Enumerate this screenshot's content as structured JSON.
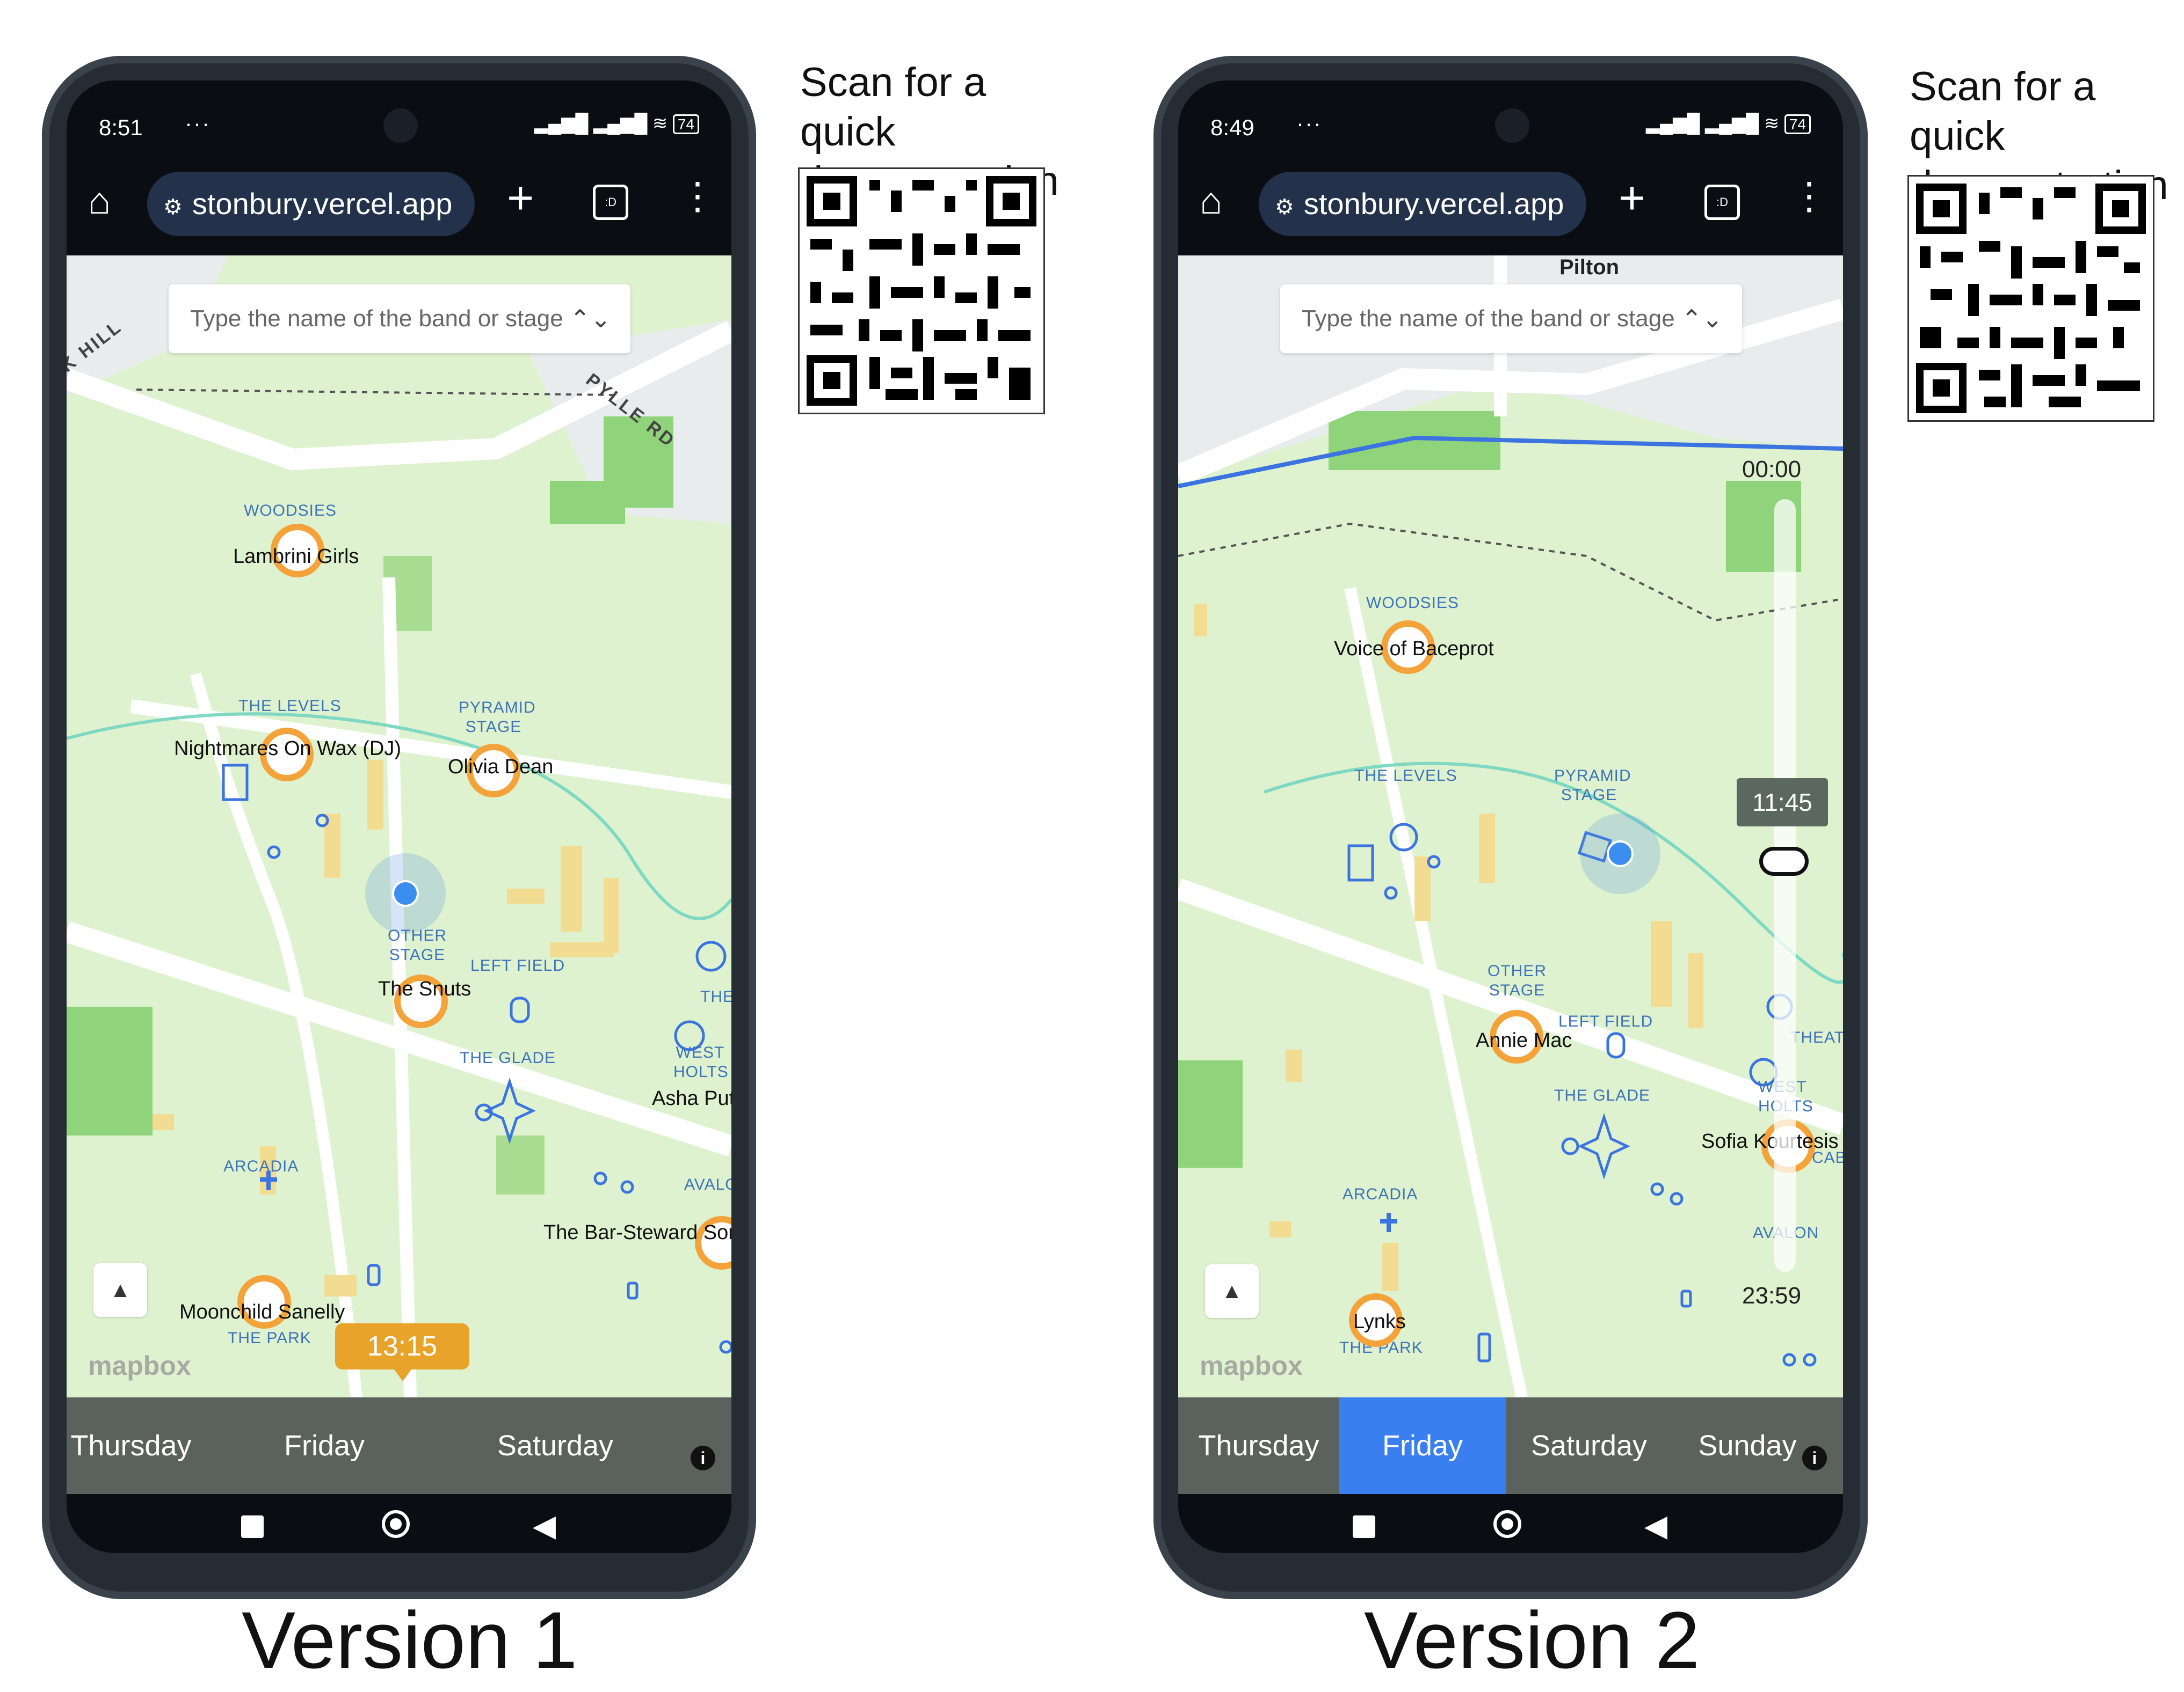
{
  "version1": {
    "status": {
      "time": "8:51",
      "dots": "···",
      "battery": "74"
    },
    "browser": {
      "url": "stonbury.vercel.app",
      "tabs_label": ":D"
    },
    "search": {
      "placeholder": "Type the name of the band or stage"
    },
    "road_labels": [
      "K HILL",
      "PYLLE RD"
    ],
    "stages": [
      {
        "name": "WOODSIES",
        "act": "Lambrini Girls"
      },
      {
        "name": "THE LEVELS",
        "act": "Nightmares On Wax (DJ)"
      },
      {
        "name": "PYRAMID STAGE",
        "act": "Olivia Dean"
      },
      {
        "name": "OTHER STAGE",
        "act": "The Snuts"
      },
      {
        "name": "LEFT FIELD",
        "act": ""
      },
      {
        "name": "THE GLADE",
        "act": ""
      },
      {
        "name": "WEST HOLTS",
        "act": "Asha Put"
      },
      {
        "name": "ARCADIA",
        "act": ""
      },
      {
        "name": "AVALON",
        "act": "The Bar-Steward Son"
      },
      {
        "name": "THE PARK",
        "act": "Moonchild Sanelly"
      },
      {
        "name": "THE",
        "act": ""
      }
    ],
    "time_tooltip": "13:15",
    "days": [
      "Thursday",
      "Friday",
      "Saturday"
    ],
    "caption": "Version 1",
    "qr_caption": "Scan for a quick demonstration"
  },
  "version2": {
    "status": {
      "time": "8:49",
      "dots": "···",
      "battery": "74"
    },
    "browser": {
      "url": "stonbury.vercel.app",
      "tabs_label": ":D"
    },
    "search": {
      "placeholder": "Type the name of the band or stage"
    },
    "place": "Pilton",
    "stages": [
      {
        "name": "WOODSIES",
        "act": "Voice of Baceprot"
      },
      {
        "name": "THE LEVELS",
        "act": ""
      },
      {
        "name": "PYRAMID STAGE",
        "act": ""
      },
      {
        "name": "OTHER STAGE",
        "act": "Annie Mac"
      },
      {
        "name": "LEFT FIELD",
        "act": ""
      },
      {
        "name": "THE GLADE",
        "act": ""
      },
      {
        "name": "WEST HOLTS",
        "act": "Sofia Kourtesis"
      },
      {
        "name": "ARCADIA",
        "act": ""
      },
      {
        "name": "AVALON",
        "act": ""
      },
      {
        "name": "THE PARK",
        "act": "Lynks"
      },
      {
        "name": "THEATRE",
        "act": ""
      },
      {
        "name": "CAB",
        "act": ""
      }
    ],
    "slider": {
      "start": "00:00",
      "current": "11:45",
      "end": "23:59"
    },
    "days": [
      "Thursday",
      "Friday",
      "Saturday",
      "Sunday"
    ],
    "active_day": "Friday",
    "caption": "Version 2",
    "qr_caption": "Scan for a quick demonstration"
  },
  "brand": "mapbox",
  "colors": {
    "ring": "#f4a33a",
    "stage_text": "#3d73b8",
    "active_day": "#3a7ff0",
    "map_bg": "#dff2d0"
  }
}
